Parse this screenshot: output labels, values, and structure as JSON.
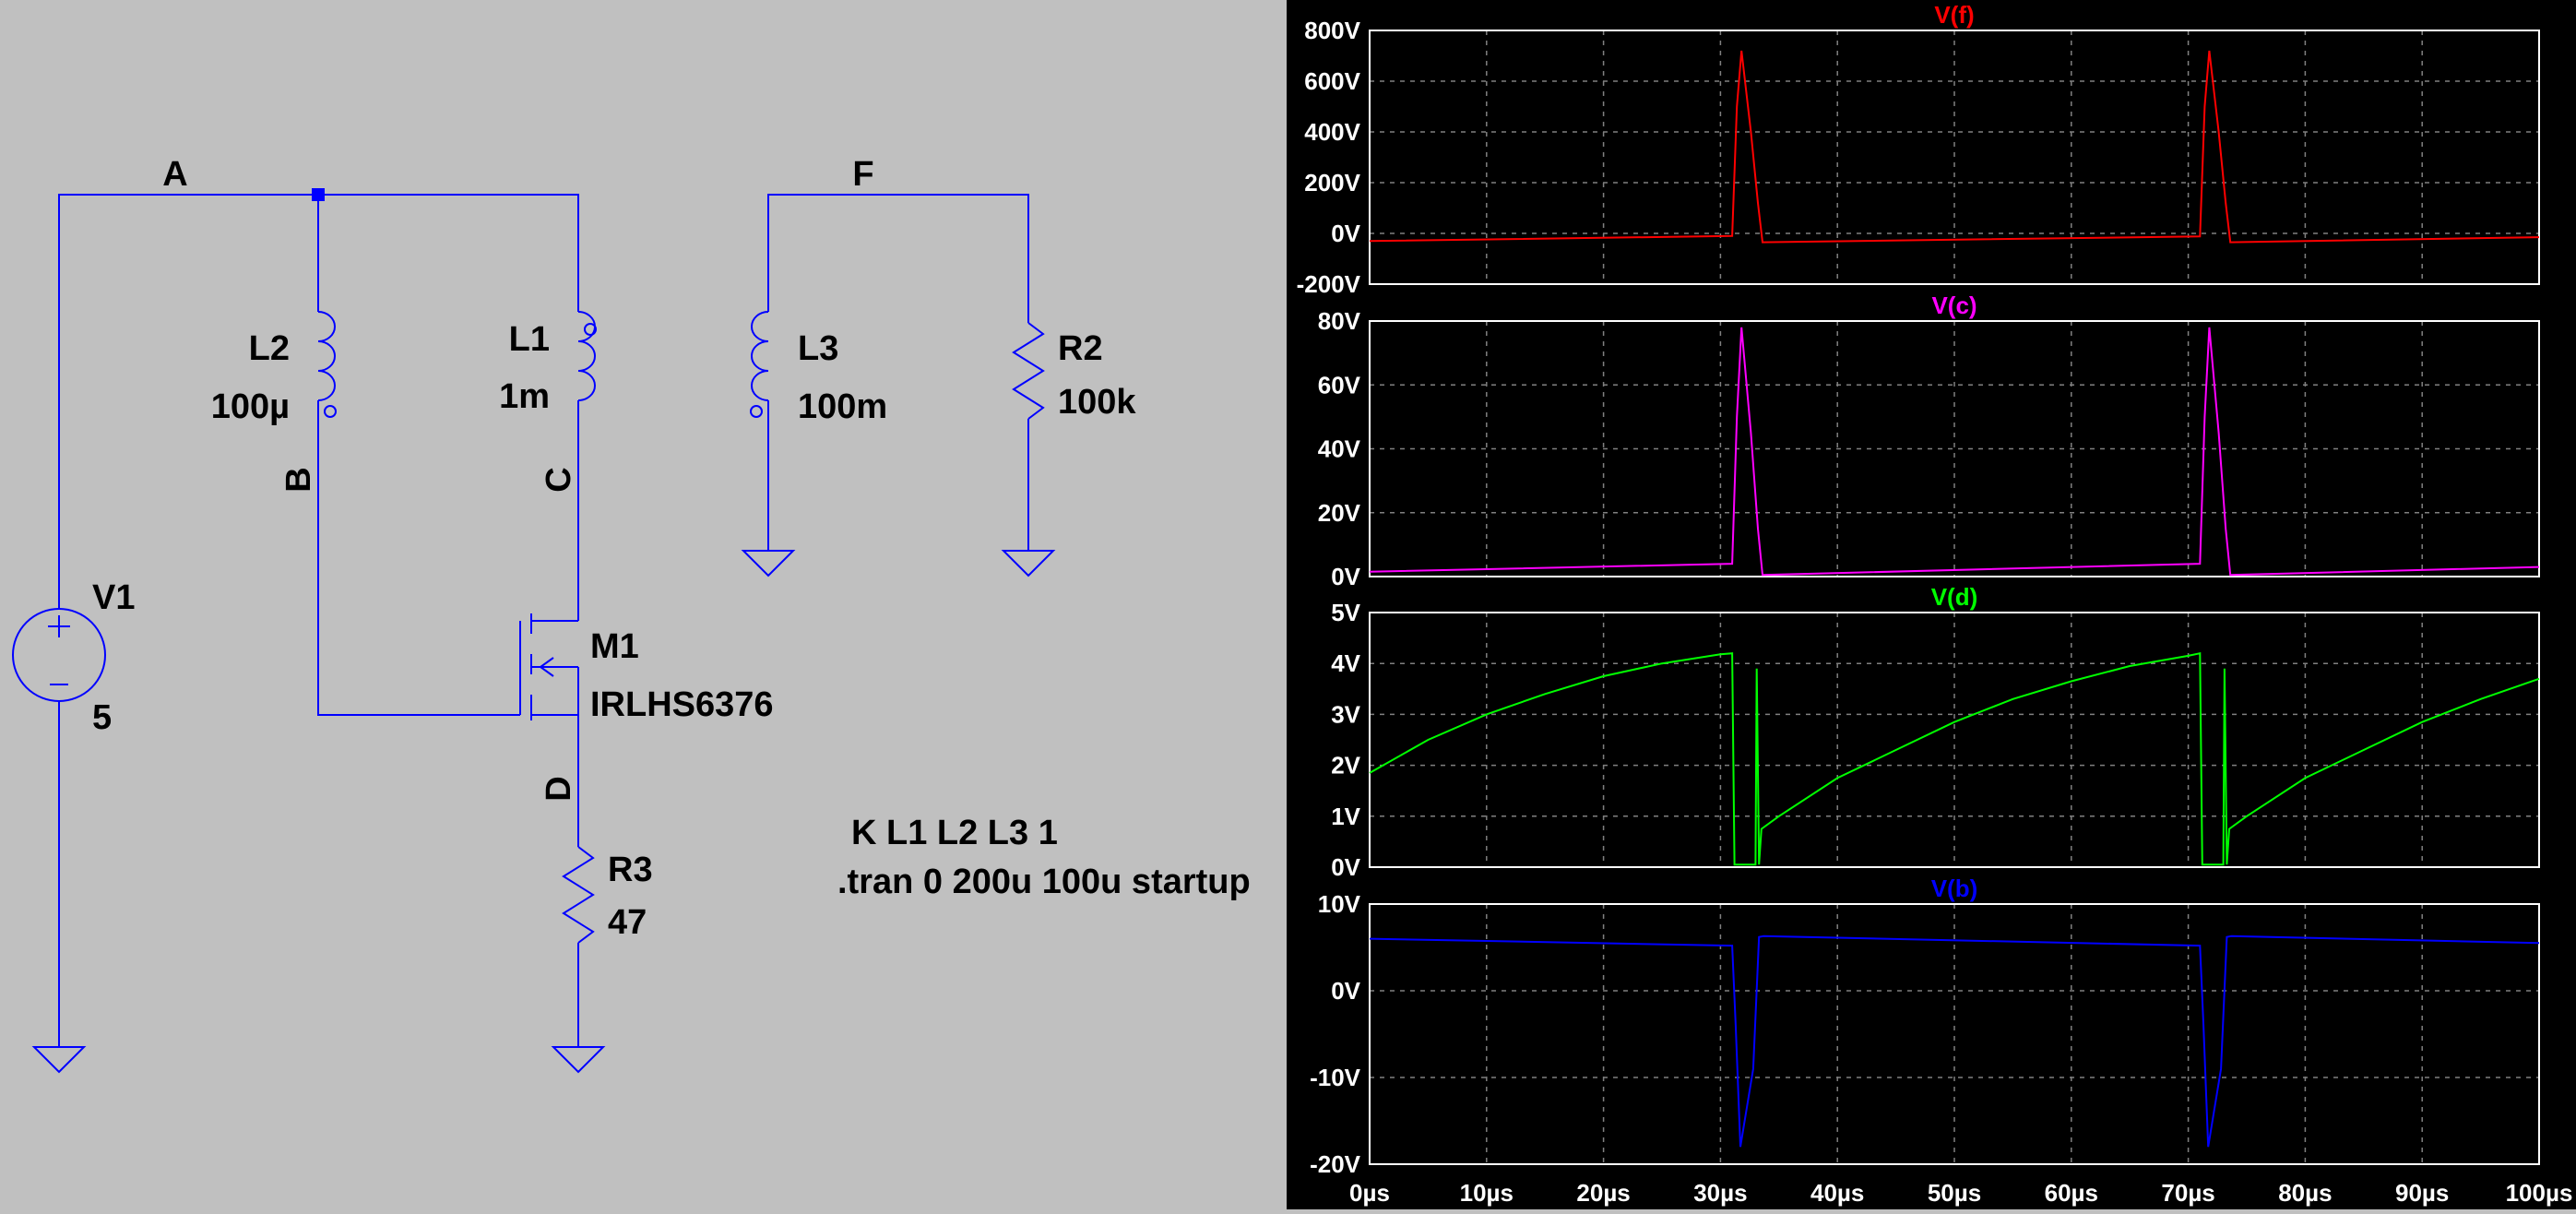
{
  "schematic": {
    "nets": {
      "a": "A",
      "f": "F",
      "b": "B",
      "c": "C",
      "d": "D"
    },
    "components": {
      "v1": {
        "name": "V1",
        "value": "5"
      },
      "l2": {
        "name": "L2",
        "value": "100µ"
      },
      "l1": {
        "name": "L1",
        "value": "1m"
      },
      "l3": {
        "name": "L3",
        "value": "100m"
      },
      "r2": {
        "name": "R2",
        "value": "100k"
      },
      "m1": {
        "name": "M1",
        "value": "IRLHS6376"
      },
      "r3": {
        "name": "R3",
        "value": "47"
      }
    },
    "directives": {
      "coupling": "K L1 L2 L3 1",
      "tran": ".tran 0 200u 100u startup"
    },
    "colors": {
      "background": "#c0c0c0",
      "wire": "#0000ff",
      "text": "#000000"
    }
  },
  "chart_data": [
    {
      "type": "line",
      "title": "V(f)",
      "color": "#ff0000",
      "ylim": [
        -200,
        800
      ],
      "yticks": [
        "800V",
        "600V",
        "400V",
        "200V",
        "0V",
        "-200V"
      ],
      "grid": true,
      "series": [
        {
          "name": "V(f)",
          "x": [
            0,
            31,
            31.4,
            31.8,
            32.6,
            33.2,
            33.6,
            71,
            71.4,
            71.8,
            72.6,
            73.2,
            73.6,
            100
          ],
          "y": [
            -30,
            -10,
            500,
            720,
            400,
            120,
            -35,
            -12,
            500,
            720,
            400,
            120,
            -35,
            -15
          ]
        }
      ]
    },
    {
      "type": "line",
      "title": "V(c)",
      "color": "#ff00ff",
      "ylim": [
        0,
        80
      ],
      "yticks": [
        "80V",
        "60V",
        "40V",
        "20V",
        "0V"
      ],
      "grid": true,
      "series": [
        {
          "name": "V(c)",
          "x": [
            0,
            31,
            31.4,
            31.8,
            32.6,
            33.2,
            33.6,
            71,
            71.4,
            71.8,
            72.6,
            73.2,
            73.6,
            100
          ],
          "y": [
            1.5,
            4,
            50,
            78,
            45,
            15,
            0.5,
            4,
            50,
            78,
            45,
            15,
            0.5,
            3
          ]
        }
      ]
    },
    {
      "type": "line",
      "title": "V(d)",
      "color": "#00ff00",
      "ylim": [
        0,
        5
      ],
      "yticks": [
        "5V",
        "4V",
        "3V",
        "2V",
        "1V",
        "0V"
      ],
      "grid": true,
      "series": [
        {
          "name": "V(d)",
          "x": [
            0,
            5,
            10,
            15,
            20,
            25,
            30,
            31,
            31.2,
            33,
            33.1,
            33.3,
            33.5,
            35,
            40,
            45,
            50,
            55,
            60,
            65,
            70,
            71,
            71.2,
            73,
            73.1,
            73.3,
            73.5,
            75,
            80,
            85,
            90,
            95,
            100
          ],
          "y": [
            1.85,
            2.5,
            3.0,
            3.4,
            3.75,
            4.0,
            4.18,
            4.2,
            0.05,
            0.05,
            3.9,
            0.05,
            0.75,
            1.0,
            1.75,
            2.3,
            2.85,
            3.3,
            3.65,
            3.95,
            4.15,
            4.2,
            0.05,
            0.05,
            3.9,
            0.05,
            0.75,
            1.0,
            1.75,
            2.3,
            2.85,
            3.3,
            3.7
          ]
        }
      ]
    },
    {
      "type": "line",
      "title": "V(b)",
      "color": "#0000ff",
      "ylim": [
        -20,
        10
      ],
      "yticks": [
        "10V",
        "0V",
        "-10V",
        "-20V"
      ],
      "grid": true,
      "xticks": [
        "0µs",
        "10µs",
        "20µs",
        "30µs",
        "40µs",
        "50µs",
        "60µs",
        "70µs",
        "80µs",
        "90µs",
        "100µs"
      ],
      "series": [
        {
          "name": "V(b)",
          "x": [
            0,
            31,
            31.3,
            31.7,
            32.8,
            33.3,
            33.7,
            71,
            71.3,
            71.7,
            72.8,
            73.3,
            73.7,
            100
          ],
          "y": [
            6,
            5.2,
            -4,
            -18,
            -9,
            6.2,
            6.3,
            5.2,
            -4,
            -18,
            -9,
            6.2,
            6.3,
            5.5
          ]
        }
      ]
    }
  ],
  "plot": {
    "background": "#000000",
    "frame": "#ffffff",
    "grid": "#808080",
    "tick_text": "#ffffff"
  }
}
